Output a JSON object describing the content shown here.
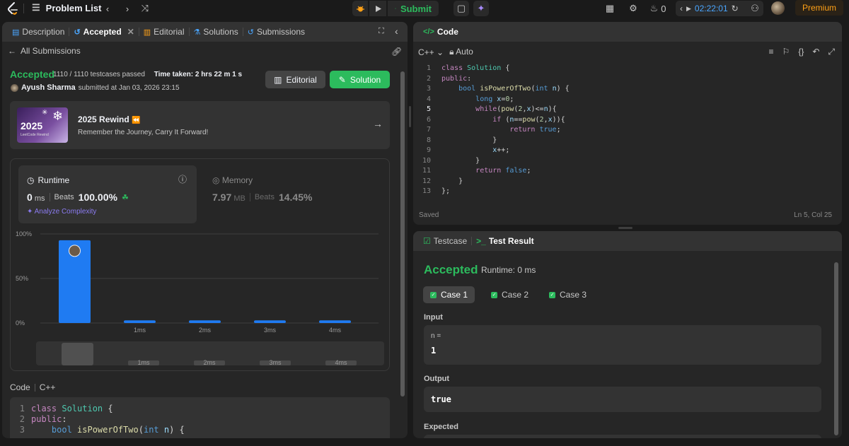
{
  "topbar": {
    "problem_list": "Problem List",
    "submit": "Submit",
    "streak": "0",
    "timer": "02:22:01",
    "premium": "Premium"
  },
  "left": {
    "tabs": [
      "Description",
      "Accepted",
      "Editorial",
      "Solutions",
      "Submissions"
    ],
    "all_submissions": "All Submissions",
    "status": "Accepted",
    "testcases": "1110 / 1110 testcases passed",
    "time_taken": "Time taken: 2 hrs 22 m 1 s",
    "user": "Ayush Sharma",
    "submitted": "submitted at Jan 03, 2026 23:15",
    "editorial_btn": "Editorial",
    "solution_btn": "Solution",
    "rewind": {
      "title": "2025 Rewind",
      "subtitle": "Remember the Journey, Carry It Forward!",
      "img_year": "2025",
      "img_caption": "LeetCode Rewind"
    },
    "runtime": {
      "label": "Runtime",
      "value": "0",
      "unit": "ms",
      "beats_label": "Beats",
      "beats": "100.00%",
      "analyze": "Analyze Complexity"
    },
    "memory": {
      "label": "Memory",
      "value": "7.97",
      "unit": "MB",
      "beats_label": "Beats",
      "beats": "14.45%"
    },
    "code_label": "Code",
    "code_lang": "C++",
    "code_lines": [
      "class Solution {",
      "public:",
      "    bool isPowerOfTwo(int n) {"
    ]
  },
  "chart_data": {
    "type": "bar",
    "categories": [
      "",
      "1ms",
      "2ms",
      "3ms",
      "4ms"
    ],
    "values": [
      93,
      3,
      3,
      3,
      3
    ],
    "ylim": [
      0,
      100
    ],
    "yticks": [
      "100%",
      "50%",
      "0%"
    ],
    "accent": "#1f7bf2",
    "navigator_labels": [
      "1ms",
      "2ms",
      "3ms",
      "4ms"
    ]
  },
  "editor": {
    "title": "Code",
    "lang": "C++",
    "mode": "Auto",
    "saved": "Saved",
    "position": "Ln 5, Col 25",
    "current_line": 5
  },
  "result": {
    "tab_testcase": "Testcase",
    "tab_result": "Test Result",
    "status": "Accepted",
    "runtime": "Runtime: 0 ms",
    "cases": [
      "Case 1",
      "Case 2",
      "Case 3"
    ],
    "input_label": "Input",
    "input_name": "n =",
    "input_value": "1",
    "output_label": "Output",
    "output_value": "true",
    "expected_label": "Expected"
  },
  "colors": {
    "accepted": "#2cbb5d",
    "premium": "#ffa116",
    "bar": "#1f7bf2",
    "timer": "#4aa6ff"
  }
}
